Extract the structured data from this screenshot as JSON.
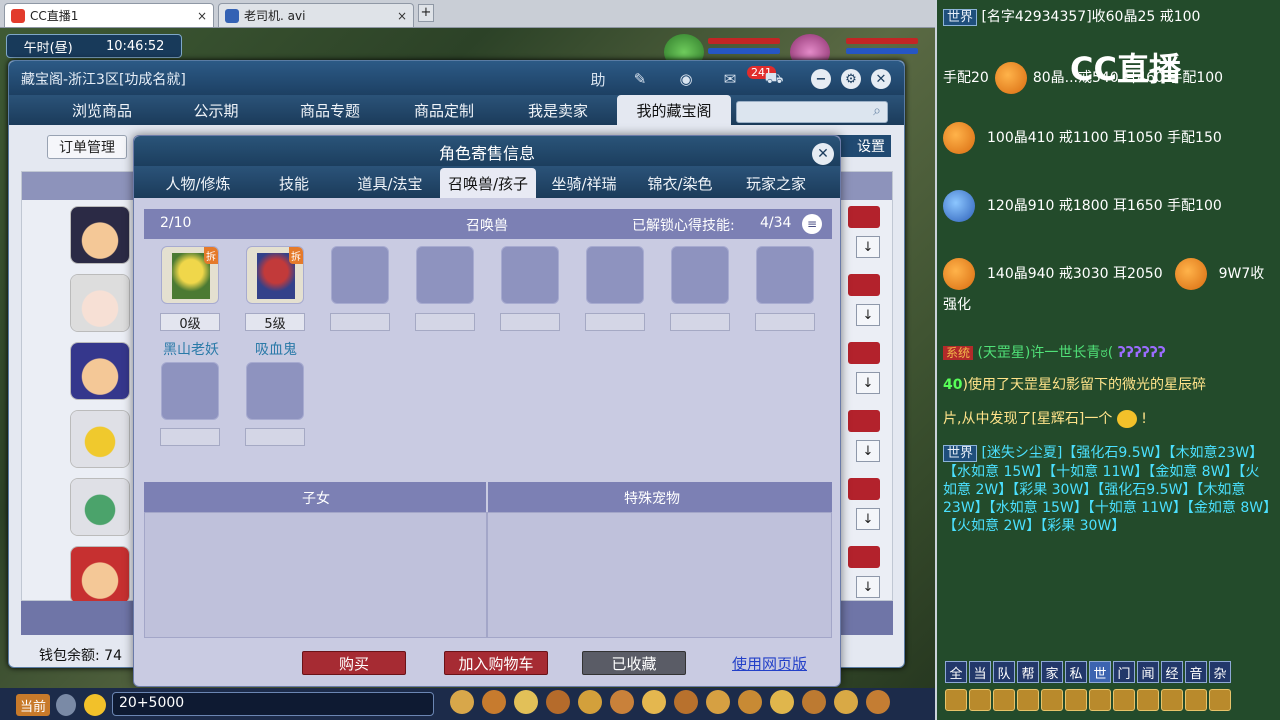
{
  "browser": {
    "tabs": [
      {
        "label": "CC直播1",
        "close": "×"
      },
      {
        "label": "老司机. avi",
        "close": "×"
      }
    ],
    "new_tab": "+"
  },
  "hud": {
    "time": "午时(昼)",
    "clock": "10:46:52"
  },
  "treasure": {
    "title": "藏宝阁-浙江3区[功成名就]",
    "icons": {
      "help": "助",
      "pin": "pin-icon",
      "record": "record-icon",
      "chat": "chat-icon",
      "cart": "cart-icon"
    },
    "badge": "241",
    "nav": [
      "浏览商品",
      "公示期",
      "商品专题",
      "商品定制",
      "我是卖家",
      "我的藏宝阁"
    ],
    "order_btn": "订单管理",
    "settings_btn": "设置",
    "wallet": "钱包余额: 74",
    "min": "−",
    "gear": "⚙",
    "close": "✕"
  },
  "dialog": {
    "title": "角色寄售信息",
    "tabs": [
      "人物/修炼",
      "技能",
      "道具/法宝",
      "召唤兽/孩子",
      "坐骑/祥瑞",
      "锦衣/染色",
      "玩家之家"
    ],
    "count": "2/10",
    "section": "召唤兽",
    "unlock_label": "已解锁心得技能:",
    "unlock_value": "4/34",
    "pets": [
      {
        "name": "黑山老妖",
        "level": "0级",
        "tag": "拆"
      },
      {
        "name": "吸血鬼",
        "level": "5级",
        "tag": "拆"
      }
    ],
    "sub_left": "子女",
    "sub_right": "特殊宠物",
    "buttons": {
      "buy": "购买",
      "add_cart": "加入购物车",
      "saved": "已收藏",
      "web": "使用网页版"
    }
  },
  "gamebar": {
    "current": "当前",
    "input": "20+5000"
  },
  "chat": {
    "logo": "CC直播",
    "line1_tag": "世界",
    "line1": "[名字42934357]收60晶25 戒100",
    "line2": "手配20",
    "line2b": "80晶...戒540 耳460 手配100",
    "line3": "100晶410 戒1100 耳1050 手配150",
    "line4": "120晶910 戒1800 耳1650 手配100",
    "line5": "140晶940 戒3030 耳2050",
    "line5b": "9W7收",
    "line6": "强化",
    "line7_tag": "系统",
    "line7": "(天罡星)许一世长青ಠ(",
    "line8_num": "40",
    "line8": ")使用了天罡星幻影留下的微光的星辰碎",
    "line9": "片,从中发现了[星辉石]一个",
    "line9b": "!",
    "line10_tag": "世界",
    "line10": "[迷失シ尘夏]【强化石9.5W】【木如意23W】【水如意 15W】【十如意 11W】【金如意 8W】【火如意 2W】【彩果 30W】【强化石9.5W】【木如意 23W】【水如意 15W】【十如意 11W】【金如意 8W】【火如意 2W】【彩果 30W】",
    "channels": [
      "全",
      "当",
      "队",
      "帮",
      "家",
      "私",
      "世",
      "门",
      "闻",
      "经",
      "音",
      "杂"
    ]
  },
  "colors": {
    "accent": "#1d3e5f",
    "red": "#b3222c",
    "link": "#2340c8",
    "chat_bg": "#234b2b"
  }
}
